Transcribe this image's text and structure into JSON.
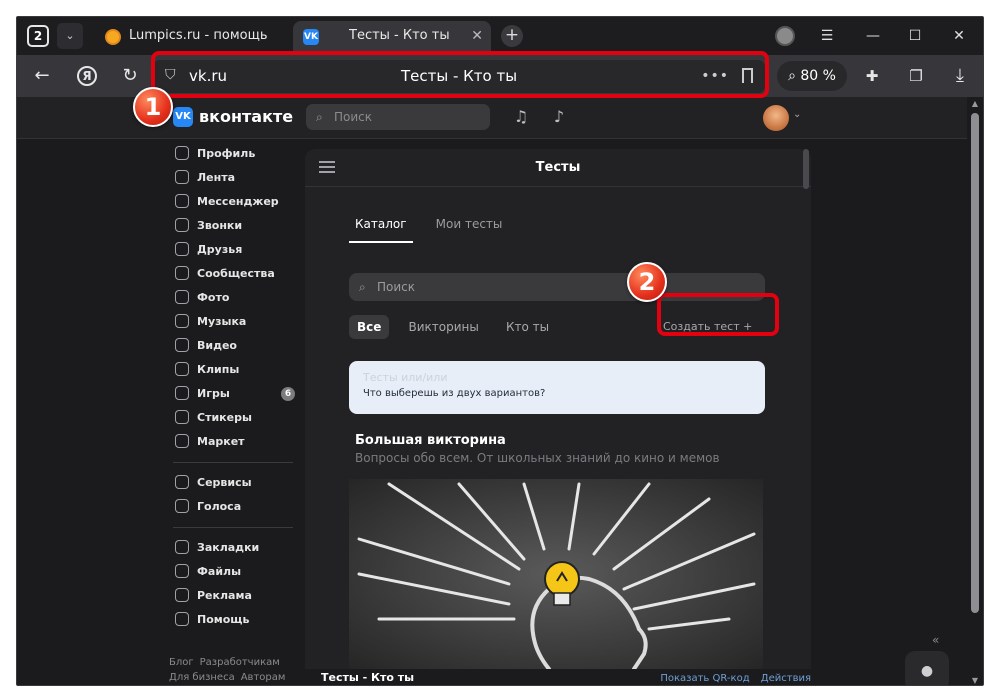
{
  "browser": {
    "tab_count": "2",
    "tabs": [
      {
        "title": "Lumpics.ru - помощь с ком",
        "close": "✕"
      },
      {
        "title": "Тесты - Кто ты",
        "close": "✕",
        "favicon": "VK"
      }
    ],
    "new_tab": "+",
    "window_buttons": {
      "menu": "☰",
      "minimize": "—",
      "maximize": "☐",
      "close": "✕"
    },
    "nav": {
      "back": "←",
      "yandex": "Я",
      "reload": "↻"
    },
    "address": {
      "domain": "vk.ru",
      "page_title": "Тесты - Кто ты",
      "more": "•••"
    },
    "zoom": "80 %",
    "toolbar_icons": [
      "extensions-icon",
      "collections-icon",
      "downloads-icon"
    ]
  },
  "annotations": [
    {
      "number": "1",
      "color": "#e3000f"
    },
    {
      "number": "2",
      "color": "#e3000f"
    }
  ],
  "vk": {
    "brand": "вконтакте",
    "logo": "VK",
    "search_placeholder": "Поиск",
    "sidebar": [
      {
        "label": "Профиль",
        "icon": "profile-icon"
      },
      {
        "label": "Лента",
        "icon": "feed-icon"
      },
      {
        "label": "Мессенджер",
        "icon": "messenger-icon"
      },
      {
        "label": "Звонки",
        "icon": "calls-icon"
      },
      {
        "label": "Друзья",
        "icon": "friends-icon"
      },
      {
        "label": "Сообщества",
        "icon": "communities-icon"
      },
      {
        "label": "Фото",
        "icon": "photo-icon"
      },
      {
        "label": "Музыка",
        "icon": "music-icon"
      },
      {
        "label": "Видео",
        "icon": "video-icon"
      },
      {
        "label": "Клипы",
        "icon": "clips-icon"
      },
      {
        "label": "Игры",
        "icon": "games-icon",
        "badge": "6"
      },
      {
        "label": "Стикеры",
        "icon": "stickers-icon"
      },
      {
        "label": "Маркет",
        "icon": "market-icon"
      }
    ],
    "sidebar2": [
      {
        "label": "Сервисы",
        "icon": "services-icon"
      },
      {
        "label": "Голоса",
        "icon": "votes-icon"
      }
    ],
    "sidebar3": [
      {
        "label": "Закладки",
        "icon": "bookmarks-icon"
      },
      {
        "label": "Файлы",
        "icon": "files-icon"
      },
      {
        "label": "Реклама",
        "icon": "ads-icon"
      },
      {
        "label": "Помощь",
        "icon": "help-icon"
      }
    ],
    "footer_links": [
      "Блог",
      "Разработчикам",
      "Для бизнеса",
      "Авторам"
    ]
  },
  "tests": {
    "title": "Тесты",
    "tabs": [
      {
        "label": "Каталог",
        "active": true
      },
      {
        "label": "Мои тесты",
        "active": false
      }
    ],
    "search_placeholder": "Поиск",
    "chips": [
      {
        "label": "Все",
        "active": true
      },
      {
        "label": "Викторины"
      },
      {
        "label": "Кто ты"
      }
    ],
    "create_button": "Создать тест",
    "create_plus": "+",
    "banner": {
      "title": "Тесты или/или",
      "text": "Что выберешь из двух вариантов?"
    },
    "section": {
      "title": "Большая викторина",
      "subtitle": "Вопросы обо всем. От школьных знаний до кино и мемов"
    }
  },
  "bottom_bar": {
    "title": "Тесты - Кто ты",
    "links": [
      "Показать QR-код",
      "Действия"
    ]
  }
}
